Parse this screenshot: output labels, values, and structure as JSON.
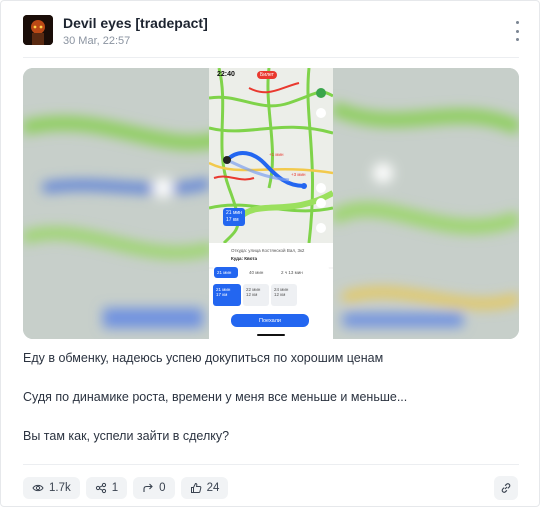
{
  "post": {
    "author": "Devil eyes [tradepact]",
    "date": "30 Mar, 22:57",
    "paragraphs": [
      "Еду в обменку, надеюсь успею докупиться по хорошим ценам",
      "Судя по динамике роста, времени у меня все меньше и меньше...",
      "Вы там как, успели зайти в сделку?"
    ]
  },
  "screenshot": {
    "time": "22:40",
    "badge": "Билет",
    "traffic_labels": [
      "+1 мин",
      "+3 мин"
    ],
    "selected_route": {
      "duration": "21 мин",
      "distance": "17 км"
    },
    "from_text": "Откуда: улица Костянской Вал, 3к2",
    "to_text": "Куда: Квота",
    "modes": [
      "21 мин",
      "40 мин",
      "2 ч 13 мин"
    ],
    "routes": [
      {
        "duration": "21 мин",
        "distance": "17 км"
      },
      {
        "duration": "22 мин",
        "distance": "12 км"
      },
      {
        "duration": "24 мин",
        "distance": "12 км"
      }
    ],
    "go_label": "Поехали"
  },
  "stats": {
    "views": "1.7k",
    "comments": "1",
    "reposts": "0",
    "likes": "24"
  },
  "colors": {
    "accent": "#2366f0",
    "traffic_green": "#7fd34a",
    "traffic_yellow": "#f2c94c",
    "traffic_red": "#e9392f"
  },
  "icons": [
    "more-vertical-icon",
    "eye-icon",
    "comment-icon",
    "repost-icon",
    "like-icon",
    "link-icon"
  ]
}
